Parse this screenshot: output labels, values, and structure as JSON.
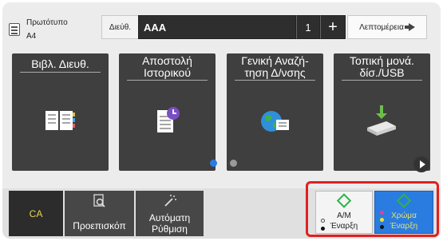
{
  "header": {
    "original_line1": "Πρωτότυπο",
    "original_line2": "A4",
    "address_label": "Διεύθ.",
    "address_value": "AAA",
    "address_count": "1",
    "add_symbol": "+",
    "details_label": "Λεπτομέρεια"
  },
  "tiles": [
    {
      "line1": "Βιβλ. Διευθ.",
      "line2": "",
      "icon": "address-book-icon"
    },
    {
      "line1": "Αποστολή",
      "line2": "Ιστορικού",
      "icon": "history-document-icon"
    },
    {
      "line1": "Γενική Αναζή-",
      "line2": "τηση Δ/νσης",
      "icon": "globe-search-icon"
    },
    {
      "line1": "Τοπική μονά.",
      "line2": "δίσ./USB",
      "icon": "usb-drive-icon"
    }
  ],
  "pager": {
    "active_page": 1,
    "total_pages": 2
  },
  "bottom": {
    "ca_label": "CA",
    "preview_label": "Προεπισκόπ",
    "auto_line1": "Αυτόματη",
    "auto_line2": "Ρύθμιση",
    "bw_line1": "Α/Μ",
    "bw_line2": "Έναρξη",
    "color_line1": "Χρώμα",
    "color_line2": "Έναρξη"
  },
  "colors": {
    "ca_text": "#e8d64a",
    "color_start_bg": "#2a7ce0",
    "highlight_frame": "#e02020",
    "active_dot": "#2a7ce0"
  }
}
